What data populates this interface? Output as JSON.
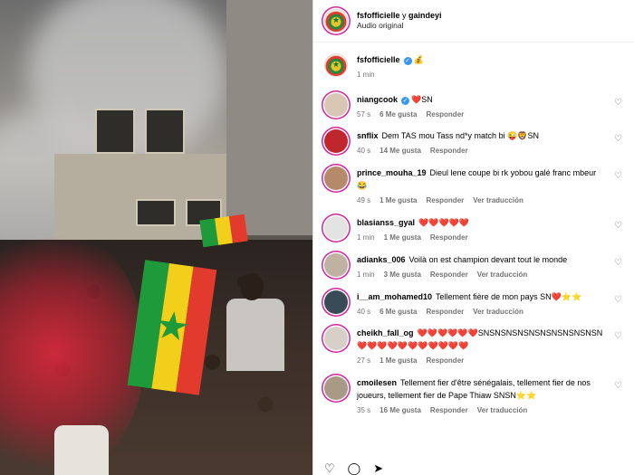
{
  "header": {
    "author_primary": "fsfofficielle",
    "separator": "y",
    "author_secondary": "gaindeyi",
    "audio": "Audio original"
  },
  "caption": {
    "username": "fsfofficielle",
    "text": "💰",
    "time": "1 min"
  },
  "labels": {
    "reply": "Responder",
    "translate": "Ver traducción"
  },
  "comments": [
    {
      "username": "niangcook",
      "verified": true,
      "text": "❤️SN",
      "time": "57 s",
      "likes": "6 Me gusta",
      "translate": false,
      "avatar_color": "#d9c6b4"
    },
    {
      "username": "snflix",
      "text": "Dem TAS mou Tass nd*y match bi 😜🦁SN",
      "time": "40 s",
      "likes": "14 Me gusta",
      "translate": false,
      "avatar_color": "#c0262d"
    },
    {
      "username": "prince_mouha_19",
      "text": "Dieul lene coupe bi rk yobou galé franc mbeur 😂",
      "time": "49 s",
      "likes": "1 Me gusta",
      "translate": true,
      "avatar_color": "#b58a6a"
    },
    {
      "username": "blasianss_gyal",
      "text": "❤️❤️❤️❤️❤️",
      "time": "1 min",
      "likes": "1 Me gusta",
      "translate": false,
      "avatar_color": "#e3e3e3"
    },
    {
      "username": "adianks_006",
      "text": "Voilà on est champion devant tout le monde",
      "time": "1 min",
      "likes": "3 Me gusta",
      "translate": true,
      "avatar_color": "#bfb2a2"
    },
    {
      "username": "i__am_mohamed10",
      "text": "Tellement fière de mon pays SN❤️⭐⭐",
      "time": "40 s",
      "likes": "6 Me gusta",
      "translate": true,
      "avatar_color": "#3a4b58"
    },
    {
      "username": "cheikh_fall_og",
      "text": "❤️❤️❤️❤️❤️❤️SNSNSNSNSNSNSNSNSNSNSN❤️❤️❤️❤️❤️❤️❤️❤️❤️❤️❤️",
      "time": "27 s",
      "likes": "1 Me gusta",
      "translate": false,
      "avatar_color": "#d6d0c9"
    },
    {
      "username": "cmoilesen",
      "text": "Tellement fier d'être sénégalais, tellement fier de nos joueurs, tellement fier de Pape Thiaw SNSN⭐⭐",
      "time": "35 s",
      "likes": "16 Me gusta",
      "translate": true,
      "avatar_color": "#a89a86"
    }
  ],
  "colors": {
    "heart": "#ed2e3a",
    "verified": "#3897f0",
    "muted": "#737373"
  },
  "icons": [
    "heart-outline-icon",
    "comment-icon",
    "share-icon",
    "verified-icon"
  ]
}
